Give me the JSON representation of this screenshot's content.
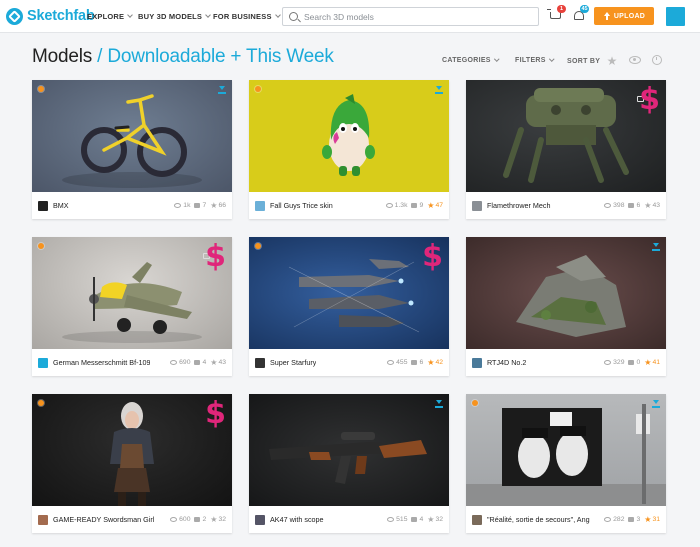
{
  "header": {
    "logo_text": "Sketchfab",
    "nav": [
      "EXPLORE",
      "BUY 3D MODELS",
      "FOR BUSINESS"
    ],
    "search_placeholder": "Search 3D models",
    "cart_count": "1",
    "notifications_count": "45",
    "upload_label": "UPLOAD"
  },
  "page": {
    "title": "Models",
    "subtitle": "/ Downloadable + This Week",
    "categories_label": "CATEGORIES",
    "filters_label": "FILTERS",
    "sortby_label": "SORT BY"
  },
  "cards": [
    {
      "title": "BMX",
      "views": "1k",
      "comments": "7",
      "likes": "66",
      "liked": false,
      "paid": false,
      "downloadable": true,
      "staff_pick": true
    },
    {
      "title": "Fall Guys Trice skin",
      "views": "1.3k",
      "comments": "9",
      "likes": "47",
      "liked": true,
      "paid": false,
      "downloadable": true,
      "staff_pick": true
    },
    {
      "title": "Flamethrower Mech",
      "views": "398",
      "comments": "6",
      "likes": "43",
      "liked": false,
      "paid": true,
      "downloadable": false,
      "staff_pick": false
    },
    {
      "title": "German Messerschmitt Bf-109",
      "views": "690",
      "comments": "4",
      "likes": "43",
      "liked": false,
      "paid": true,
      "downloadable": false,
      "staff_pick": true
    },
    {
      "title": "Super Starfury",
      "views": "455",
      "comments": "6",
      "likes": "42",
      "liked": true,
      "paid": true,
      "downloadable": false,
      "staff_pick": true
    },
    {
      "title": "RTJ4D No.2",
      "views": "329",
      "comments": "0",
      "likes": "41",
      "liked": true,
      "paid": false,
      "downloadable": true,
      "staff_pick": false
    },
    {
      "title": "GAME-READY Swordsman Girl",
      "views": "600",
      "comments": "2",
      "likes": "32",
      "liked": false,
      "paid": true,
      "downloadable": false,
      "staff_pick": true
    },
    {
      "title": "AK47 with scope",
      "views": "515",
      "comments": "4",
      "likes": "32",
      "liked": false,
      "paid": false,
      "downloadable": true,
      "staff_pick": false
    },
    {
      "title": "\"Réalité, sortie de secours\", Ang",
      "views": "282",
      "comments": "3",
      "likes": "31",
      "liked": true,
      "paid": false,
      "downloadable": true,
      "staff_pick": true
    }
  ],
  "colors": {
    "accent": "#1caad9",
    "upload": "#f7931e",
    "paid": "#e0267a",
    "star": "#f7931e"
  }
}
